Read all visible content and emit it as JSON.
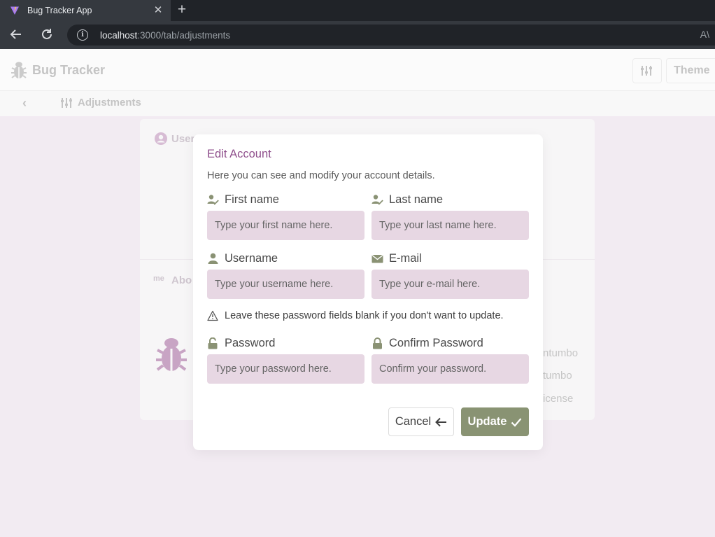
{
  "browser": {
    "tab_title": "Bug Tracker App",
    "url_host": "localhost",
    "url_path": ":3000/tab/adjustments"
  },
  "app": {
    "brand": "Bug Tracker",
    "theme_label": "Theme",
    "breadcrumb": "Adjustments",
    "background_card": {
      "section1": "User",
      "section2": "Abo",
      "right_line1": "ntumbo",
      "right_line2": "tumbo",
      "right_line3": "icense"
    }
  },
  "modal": {
    "title": "Edit Account",
    "subtitle": "Here you can see and modify your account details.",
    "first_name_label": "First name",
    "first_name_placeholder": "Type your first name here.",
    "last_name_label": "Last name",
    "last_name_placeholder": "Type your last name here.",
    "username_label": "Username",
    "username_placeholder": "Type your username here.",
    "email_label": "E-mail",
    "email_placeholder": "Type your e-mail here.",
    "warning": "Leave these password fields blank if you don't want to update.",
    "password_label": "Password",
    "password_placeholder": "Type your password here.",
    "confirm_label": "Confirm Password",
    "confirm_placeholder": "Confirm your password.",
    "cancel_label": "Cancel",
    "update_label": "Update"
  },
  "colors": {
    "accent_purple": "#8f4f8c",
    "input_bg": "#e7d7e3",
    "update_button": "#899373",
    "icon_olive": "#8a9274"
  },
  "icons": [
    "vite-favicon",
    "close-icon",
    "plus-icon",
    "back-arrow-icon",
    "reload-icon",
    "info-icon",
    "reader-icon",
    "bug-icon",
    "sliders-icon",
    "chevron-left-icon",
    "user-edit-icon",
    "user-icon",
    "envelope-icon",
    "warning-icon",
    "unlock-icon",
    "lock-icon",
    "arrow-left-icon",
    "check-icon"
  ]
}
